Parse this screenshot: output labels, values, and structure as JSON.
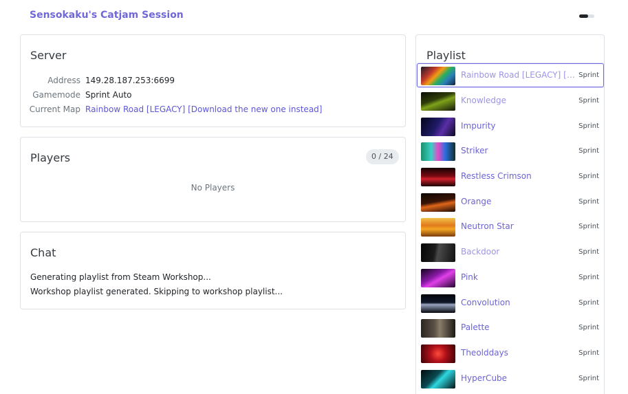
{
  "app": {
    "title": "Sensokaku's Catjam Session"
  },
  "server": {
    "title": "Server",
    "fields": [
      {
        "label": "Address",
        "value": "149.28.187.253:6699"
      },
      {
        "label": "Gamemode",
        "value": "Sprint Auto"
      },
      {
        "label": "Current Map",
        "value": "Rainbow Road [LEGACY] [Download the new one instead]"
      }
    ]
  },
  "players": {
    "title": "Players",
    "count": "0 / 24",
    "empty_text": "No Players"
  },
  "chat": {
    "title": "Chat",
    "messages": [
      "Generating playlist from Steam Workshop...",
      "Workshop playlist generated. Skipping to workshop playlist..."
    ]
  },
  "playlist": {
    "title": "Playlist",
    "items": [
      {
        "name": "Rainbow Road [LEGACY] [Download the new one instead]",
        "mode": "Sprint",
        "active": true
      },
      {
        "name": "Knowledge",
        "mode": "Sprint"
      },
      {
        "name": "Impurity",
        "mode": "Sprint"
      },
      {
        "name": "Striker",
        "mode": "Sprint"
      },
      {
        "name": "Restless Crimson",
        "mode": "Sprint"
      },
      {
        "name": "Orange",
        "mode": "Sprint"
      },
      {
        "name": "Neutron Star",
        "mode": "Sprint"
      },
      {
        "name": "Backdoor",
        "mode": "Sprint"
      },
      {
        "name": "Pink",
        "mode": "Sprint"
      },
      {
        "name": "Convolution",
        "mode": "Sprint"
      },
      {
        "name": "Palette",
        "mode": "Sprint"
      },
      {
        "name": "Theolddays",
        "mode": "Sprint"
      },
      {
        "name": "HyperCube",
        "mode": "Sprint"
      }
    ]
  },
  "colors": {
    "accent": "#7068d8",
    "link": "#5d57d6",
    "border": "#dee2e6"
  }
}
